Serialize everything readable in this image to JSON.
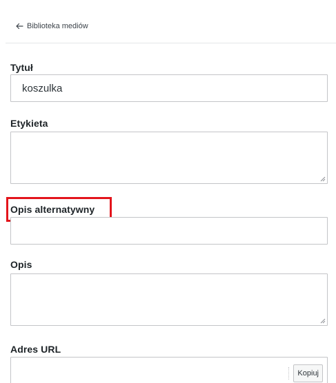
{
  "header": {
    "back_label": "Biblioteka mediów"
  },
  "fields": {
    "title": {
      "label": "Tytuł",
      "value": "koszulka"
    },
    "caption": {
      "label": "Etykieta",
      "value": ""
    },
    "alt_text": {
      "label": "Opis alternatywny",
      "value": ""
    },
    "description": {
      "label": "Opis",
      "value": ""
    },
    "url": {
      "label": "Adres URL",
      "copy_label": "Kopiuj"
    }
  },
  "annotation": {
    "highlight_color": "#e3141b"
  }
}
